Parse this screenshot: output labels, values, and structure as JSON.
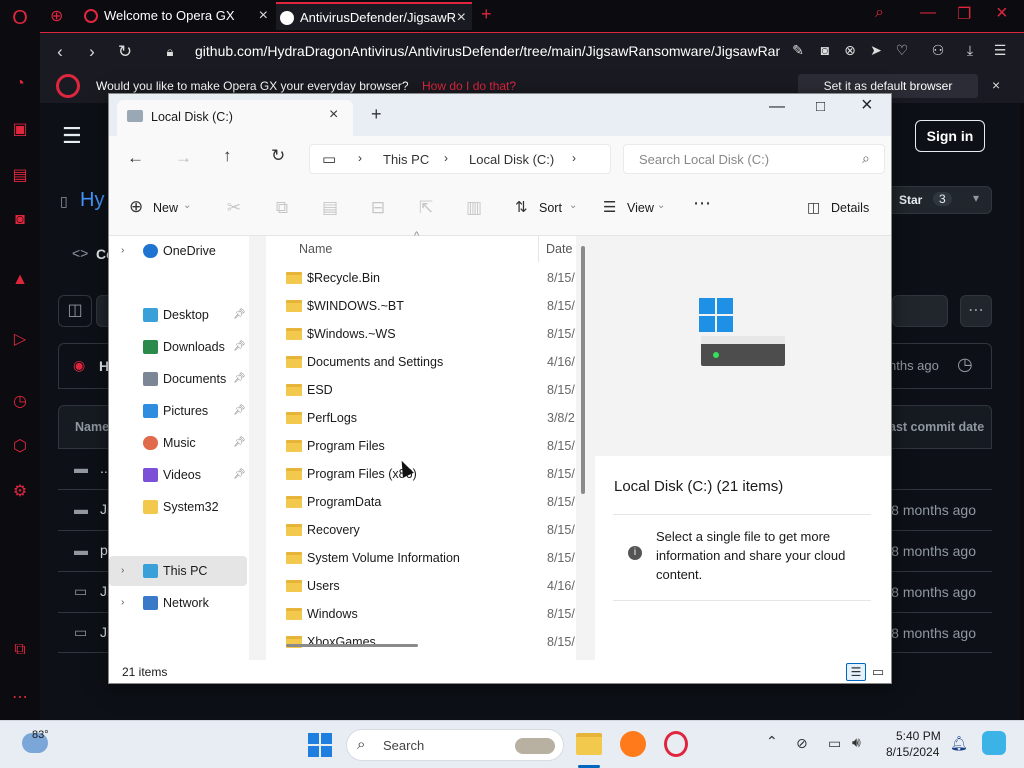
{
  "browser": {
    "tabs": [
      {
        "label": "Welcome to Opera GX"
      },
      {
        "label": "AntivirusDefender/JigsawR"
      }
    ],
    "url": "github.com/HydraDragonAntivirus/AntivirusDefender/tree/main/JigsawRansomware/JigsawRansomwa",
    "infobar": {
      "message": "Would you like to make Opera GX your everyday browser?",
      "link": "How do I do that?",
      "button": "Set it as default browser"
    }
  },
  "github": {
    "sign_in": "Sign in",
    "repo_title": "Hy",
    "code_tab": "Co",
    "star_label": "Star",
    "star_count": "3",
    "branch_prefix": "H",
    "last_commit": "nths ago",
    "name_header": "Name",
    "date_header": "ast commit date",
    "rows": [
      {
        "name": "..",
        "date": ""
      },
      {
        "name": "Ji",
        "date": "8 months ago"
      },
      {
        "name": "p",
        "date": "8 months ago"
      },
      {
        "name": "Ji",
        "date": "8 months ago"
      },
      {
        "name": "Ji",
        "date": "8 months ago"
      }
    ]
  },
  "explorer": {
    "tab_title": "Local Disk (C:)",
    "breadcrumb": [
      "This PC",
      "Local Disk (C:)"
    ],
    "search_placeholder": "Search Local Disk (C:)",
    "commands": {
      "new": "New",
      "sort": "Sort",
      "view": "View",
      "details": "Details"
    },
    "nav_items": [
      {
        "label": "OneDrive",
        "icon": "cloud-icon",
        "color": "#1f73d1"
      },
      {
        "label": "Desktop",
        "icon": "desktop-folder-icon",
        "color": "#3aa0d8"
      },
      {
        "label": "Downloads",
        "icon": "download-icon",
        "color": "#2a8a4a"
      },
      {
        "label": "Documents",
        "icon": "documents-icon",
        "color": "#7b8794"
      },
      {
        "label": "Pictures",
        "icon": "pictures-icon",
        "color": "#2f8de0"
      },
      {
        "label": "Music",
        "icon": "music-icon",
        "color": "#e06a4a"
      },
      {
        "label": "Videos",
        "icon": "videos-icon",
        "color": "#7b4fd6"
      },
      {
        "label": "System32",
        "icon": "folder-icon",
        "color": "#f2c94c"
      },
      {
        "label": "This PC",
        "icon": "computer-icon",
        "color": "#3aa0d8"
      },
      {
        "label": "Network",
        "icon": "network-icon",
        "color": "#3a78c8"
      }
    ],
    "columns": {
      "name": "Name",
      "date": "Date"
    },
    "files": [
      {
        "name": "$Recycle.Bin",
        "date": "8/15/"
      },
      {
        "name": "$WINDOWS.~BT",
        "date": "8/15/"
      },
      {
        "name": "$Windows.~WS",
        "date": "8/15/"
      },
      {
        "name": "Documents and Settings",
        "date": "4/16/"
      },
      {
        "name": "ESD",
        "date": "8/15/"
      },
      {
        "name": "PerfLogs",
        "date": "3/8/2"
      },
      {
        "name": "Program Files",
        "date": "8/15/"
      },
      {
        "name": "Program Files (x86)",
        "date": "8/15/"
      },
      {
        "name": "ProgramData",
        "date": "8/15/"
      },
      {
        "name": "Recovery",
        "date": "8/15/"
      },
      {
        "name": "System Volume Information",
        "date": "8/15/"
      },
      {
        "name": "Users",
        "date": "4/16/"
      },
      {
        "name": "Windows",
        "date": "8/15/"
      },
      {
        "name": "XboxGames",
        "date": "8/15/"
      }
    ],
    "details_title": "Local Disk (C:) (21 items)",
    "details_info": "Select a single file to get more information and share your cloud content.",
    "status": "21 items"
  },
  "taskbar": {
    "weather": "83°",
    "search": "Search",
    "time": "5:40 PM",
    "date": "8/15/2024"
  }
}
